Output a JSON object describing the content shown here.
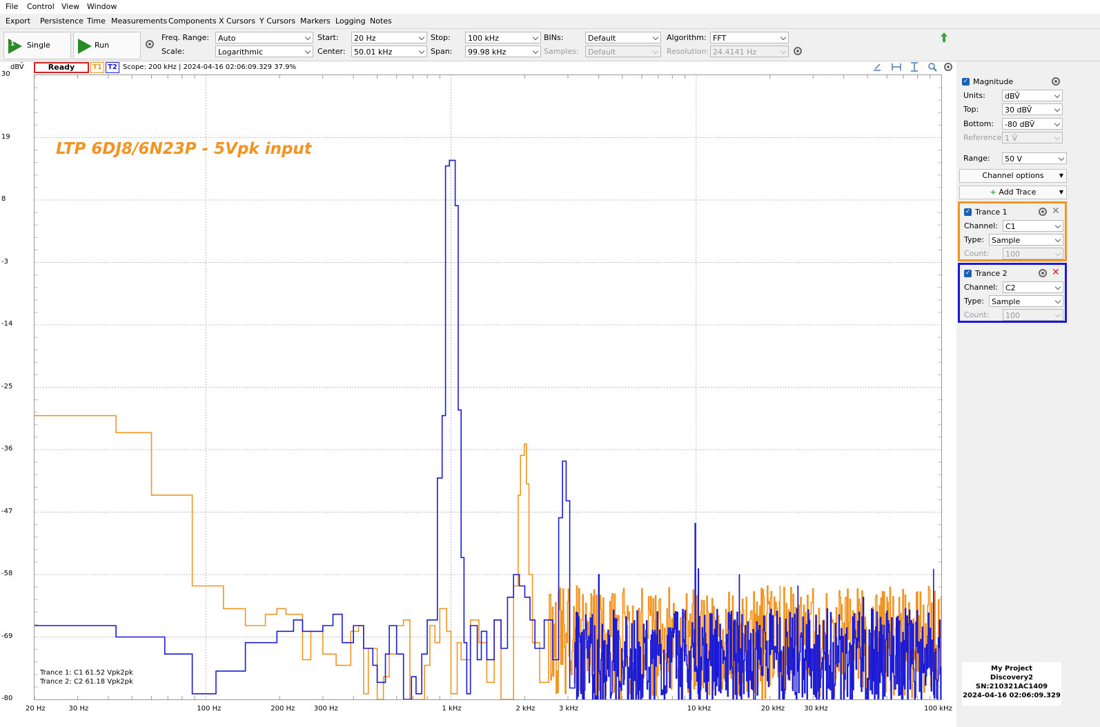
{
  "menu": [
    "File",
    "Control",
    "View",
    "Window"
  ],
  "submenu": [
    "Export",
    "Persistence",
    "Time",
    "Measurements",
    "Components",
    "X Cursors",
    "Y Cursors",
    "Markers",
    "Logging",
    "Notes"
  ],
  "toolbar": {
    "single_label": "Single",
    "run_label": "Run",
    "freq_range_label": "Freq. Range:",
    "freq_range_value": "Auto",
    "scale_label": "Scale:",
    "scale_value": "Logarithmic",
    "start_label": "Start:",
    "start_value": "20 Hz",
    "center_label": "Center:",
    "center_value": "50.01 kHz",
    "stop_label": "Stop:",
    "stop_value": "100 kHz",
    "span_label": "Span:",
    "span_value": "99.98 kHz",
    "bins_label": "BINs:",
    "bins_value": "Default",
    "samples_label": "Samples:",
    "samples_value": "Default",
    "algorithm_label": "Algorithm:",
    "algorithm_value": "FFT",
    "resolution_label": "Resolution:",
    "resolution_value": "24.4141 Hz"
  },
  "status": {
    "units": "dBV̄",
    "state": "Ready",
    "t1": "T1",
    "t2": "T2",
    "info": "Scope: 200 kHz | 2024-04-16 02:06:09.329 37.9%",
    "y_button": "Y"
  },
  "plot": {
    "annotation": "LTP 6DJ8/6N23P - 5Vpk input",
    "y_ticks": [
      "30",
      "19",
      "8",
      "-3",
      "-14",
      "-25",
      "-36",
      "-47",
      "-58",
      "-69",
      "-80"
    ],
    "x_ticks": [
      "20 Hz",
      "30 Hz",
      "100 Hz",
      "200 Hz",
      "300 Hz",
      "1 kHz",
      "2 kHz",
      "3 kHz",
      "10 kHz",
      "20 kHz",
      "30 kHz",
      "100 kHz"
    ],
    "legend1": "Trance 1: C1 61.52 Vpk2pk",
    "legend2": "Trance 2: C2 61.18 Vpk2pk",
    "trace1_color": "#f29422",
    "trace2_color": "#1a1ad6"
  },
  "panel": {
    "magnitude_label": "Magnitude",
    "units_label": "Units:",
    "units_value": "dBV̄",
    "top_label": "Top:",
    "top_value": "30 dBV̄",
    "bottom_label": "Bottom:",
    "bottom_value": "-80 dBV̄",
    "reference_label": "Reference:",
    "reference_value": "1 V̄",
    "range_label": "Range:",
    "range_value": "50 V",
    "channel_options": "Channel options",
    "add_trace": "Add Trace",
    "trace1": {
      "title": "Trance 1",
      "channel_label": "Channel:",
      "channel_value": "C1",
      "type_label": "Type:",
      "type_value": "Sample",
      "count_label": "Count:",
      "count_value": "100"
    },
    "trace2": {
      "title": "Trance 2",
      "channel_label": "Channel:",
      "channel_value": "C2",
      "type_label": "Type:",
      "type_value": "Sample",
      "count_label": "Count:",
      "count_value": "100"
    },
    "project": {
      "line1": "My Project",
      "line2": "Discovery2",
      "line3": "SN:210321AC1409",
      "line4": "2024-04-16 02:06:09.329"
    }
  }
}
